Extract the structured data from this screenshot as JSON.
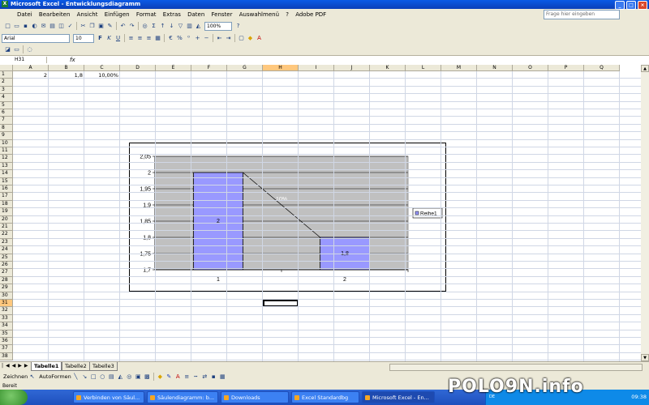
{
  "window": {
    "title": "Microsoft Excel - Entwicklungsdiagramm",
    "app_icon": "X"
  },
  "menu": [
    "Datei",
    "Bearbeiten",
    "Ansicht",
    "Einfügen",
    "Format",
    "Extras",
    "Daten",
    "Fenster",
    "Auswahlmenü",
    "?",
    "Adobe PDF"
  ],
  "help_placeholder": "Frage hier eingeben",
  "toolbar": {
    "zoom": "100%",
    "font": "Arial",
    "size": "10"
  },
  "formula": {
    "namebox": "H31",
    "fx": "fx",
    "content": ""
  },
  "columns": [
    "A",
    "B",
    "C",
    "D",
    "E",
    "F",
    "G",
    "H",
    "I",
    "J",
    "K",
    "L",
    "M",
    "N",
    "O",
    "P",
    "Q"
  ],
  "selected_column": "H",
  "selected_row": 31,
  "rows": [
    1,
    2,
    3,
    4,
    5,
    6,
    7,
    8,
    9,
    10,
    11,
    12,
    13,
    14,
    15,
    16,
    17,
    18,
    19,
    20,
    21,
    22,
    23,
    24,
    25,
    26,
    27,
    28,
    29,
    30,
    31,
    32,
    33,
    34,
    35,
    36,
    37,
    38
  ],
  "cells": {
    "A1": "2",
    "B1": "1,8",
    "C1": "10,00%"
  },
  "chart_data": {
    "type": "bar",
    "categories": [
      "1",
      "2"
    ],
    "series": [
      {
        "name": "Reihe1",
        "values": [
          2,
          1.8
        ],
        "color": "#9999ff",
        "data_labels": [
          "2",
          "1,8"
        ]
      }
    ],
    "ylim": [
      1.7,
      2.05
    ],
    "yticks": [
      "1,7",
      "1,75",
      "1,8",
      "1,85",
      "1,9",
      "1,95",
      "2",
      "2,05"
    ],
    "plot_background": "#c0c0c0",
    "grid": true,
    "annotation": {
      "text": "10%",
      "kind": "trendline between bar tops"
    },
    "legend": "right",
    "title": "",
    "xlabel": "",
    "ylabel": ""
  },
  "sheets": [
    "Tabelle1",
    "Tabelle2",
    "Tabelle3"
  ],
  "active_sheet": "Tabelle1",
  "drawbar": {
    "draw": "Zeichnen",
    "autoshapes": "AutoFormen"
  },
  "status": "Bereit",
  "taskbar": {
    "tasks": [
      "Verbinden von Säul...",
      "Säulendiagramm: b...",
      "Downloads",
      "Excel Standardbg",
      "Microsoft Excel - En..."
    ],
    "active": 4,
    "lang": "DE",
    "clock": "09:38"
  },
  "watermark": "POLO9N.info"
}
